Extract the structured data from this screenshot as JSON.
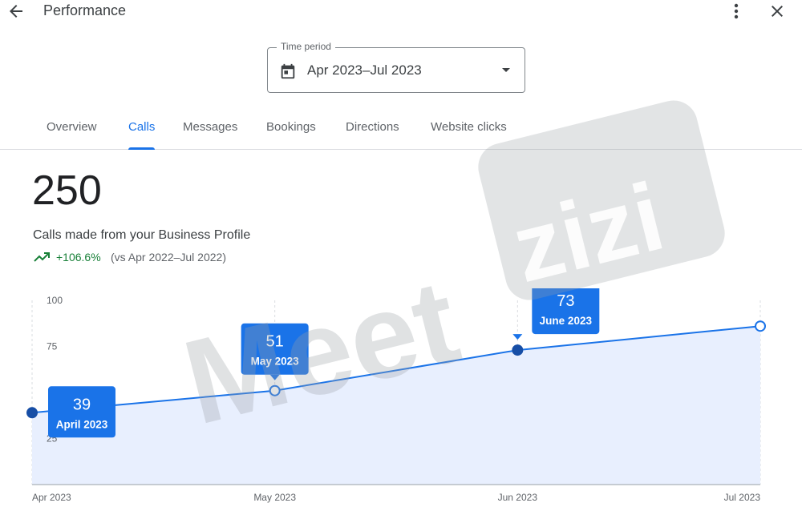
{
  "header": {
    "title": "Performance",
    "back_icon": "arrow-back-icon",
    "more_icon": "more-vert-icon",
    "close_icon": "close-icon"
  },
  "time_period": {
    "label": "Time period",
    "value": "Apr 2023–Jul 2023",
    "icon": "calendar-icon"
  },
  "tabs": [
    {
      "label": "Overview",
      "active": false
    },
    {
      "label": "Calls",
      "active": true
    },
    {
      "label": "Messages",
      "active": false
    },
    {
      "label": "Bookings",
      "active": false
    },
    {
      "label": "Directions",
      "active": false
    },
    {
      "label": "Website clicks",
      "active": false
    }
  ],
  "metric": {
    "value": "250",
    "label": "Calls made from your Business Profile",
    "change": "+106.6%",
    "comparison": "(vs Apr 2022–Jul 2022)",
    "trend_icon": "trending-up-icon"
  },
  "colors": {
    "accent": "#1a73e8",
    "line": "#1a73e8",
    "area": "#e8effe",
    "positive": "#188038",
    "tooltip": "#1a73e8"
  },
  "chart_data": {
    "type": "area",
    "x": [
      "Apr 2023",
      "May 2023",
      "Jun 2023",
      "Jul 2023"
    ],
    "y_ticks": [
      "100",
      "75",
      "25"
    ],
    "ylim": [
      0,
      100
    ],
    "series": [
      {
        "values": [
          39,
          51,
          73,
          86
        ]
      }
    ],
    "annotations": [
      {
        "value": "39",
        "label": "April 2023",
        "index": 0
      },
      {
        "value": "51",
        "label": "May 2023",
        "index": 1
      },
      {
        "value": "73",
        "label": "June 2023",
        "index": 2
      }
    ]
  },
  "watermark": {
    "text": "Meetzizi"
  }
}
